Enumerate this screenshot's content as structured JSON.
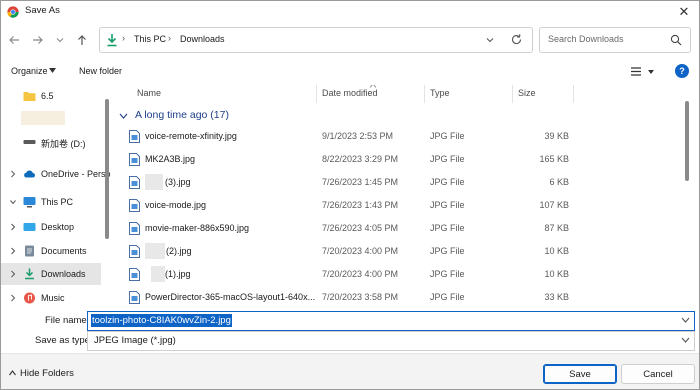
{
  "window": {
    "title": "Save As",
    "close": "✕"
  },
  "address": {
    "crumbs": [
      "This PC",
      "Downloads"
    ],
    "separator": "›"
  },
  "search": {
    "placeholder": "Search Downloads"
  },
  "toolbar": {
    "organize": "Organize",
    "new_folder": "New folder"
  },
  "nav": {
    "items": [
      {
        "label": "6.5",
        "icon": "folder-icon"
      },
      {
        "label": "",
        "icon": "blurred-folder"
      },
      {
        "label": "新加卷 (D:)",
        "icon": "drive-icon"
      },
      {
        "label": "OneDrive - Perso",
        "icon": "onedrive-cloud-icon"
      },
      {
        "label": "This PC",
        "icon": "this-pc-icon"
      },
      {
        "label": "Desktop",
        "icon": "desktop-folder-icon"
      },
      {
        "label": "Documents",
        "icon": "documents-folder-icon"
      },
      {
        "label": "Downloads",
        "icon": "downloads-folder-icon",
        "selected": true
      },
      {
        "label": "Music",
        "icon": "music-folder-icon"
      }
    ]
  },
  "columns": {
    "name": "Name",
    "date": "Date modified",
    "type": "Type",
    "size": "Size"
  },
  "group": {
    "label": "A long time ago (17)"
  },
  "files": [
    {
      "name": "voice-remote-xfinity.jpg",
      "date": "9/1/2023 2:53 PM",
      "type": "JPG File",
      "size": "39 KB"
    },
    {
      "name": "MK2A3B.jpg",
      "date": "8/22/2023 3:29 PM",
      "type": "JPG File",
      "size": "165 KB"
    },
    {
      "name": "(3).jpg",
      "date": "7/26/2023 1:45 PM",
      "type": "JPG File",
      "size": "6 KB",
      "blurred": true
    },
    {
      "name": "voice-mode.jpg",
      "date": "7/26/2023 1:43 PM",
      "type": "JPG File",
      "size": "107 KB"
    },
    {
      "name": "movie-maker-886x590.jpg",
      "date": "7/26/2023 4:05 PM",
      "type": "JPG File",
      "size": "87 KB"
    },
    {
      "name": "(2).jpg",
      "date": "7/20/2023 4:00 PM",
      "type": "JPG File",
      "size": "10 KB",
      "blurred": true
    },
    {
      "name": "(1).jpg",
      "date": "7/20/2023 4:00 PM",
      "type": "JPG File",
      "size": "10 KB",
      "blurred": true
    },
    {
      "name": "PowerDirector-365-macOS-layout1-640x...",
      "date": "7/20/2023 3:58 PM",
      "type": "JPG File",
      "size": "33 KB"
    }
  ],
  "form": {
    "filename_label": "File name:",
    "filename_value": "toolzin-photo-C8IAK0wvZin-2.jpg",
    "type_label": "Save as type:",
    "type_value": "JPEG Image (*.jpg)"
  },
  "footer": {
    "hide_folders": "Hide Folders",
    "save": "Save",
    "cancel": "Cancel"
  },
  "colors": {
    "accent": "#0d63c6",
    "group_text": "#1e3f8a"
  }
}
